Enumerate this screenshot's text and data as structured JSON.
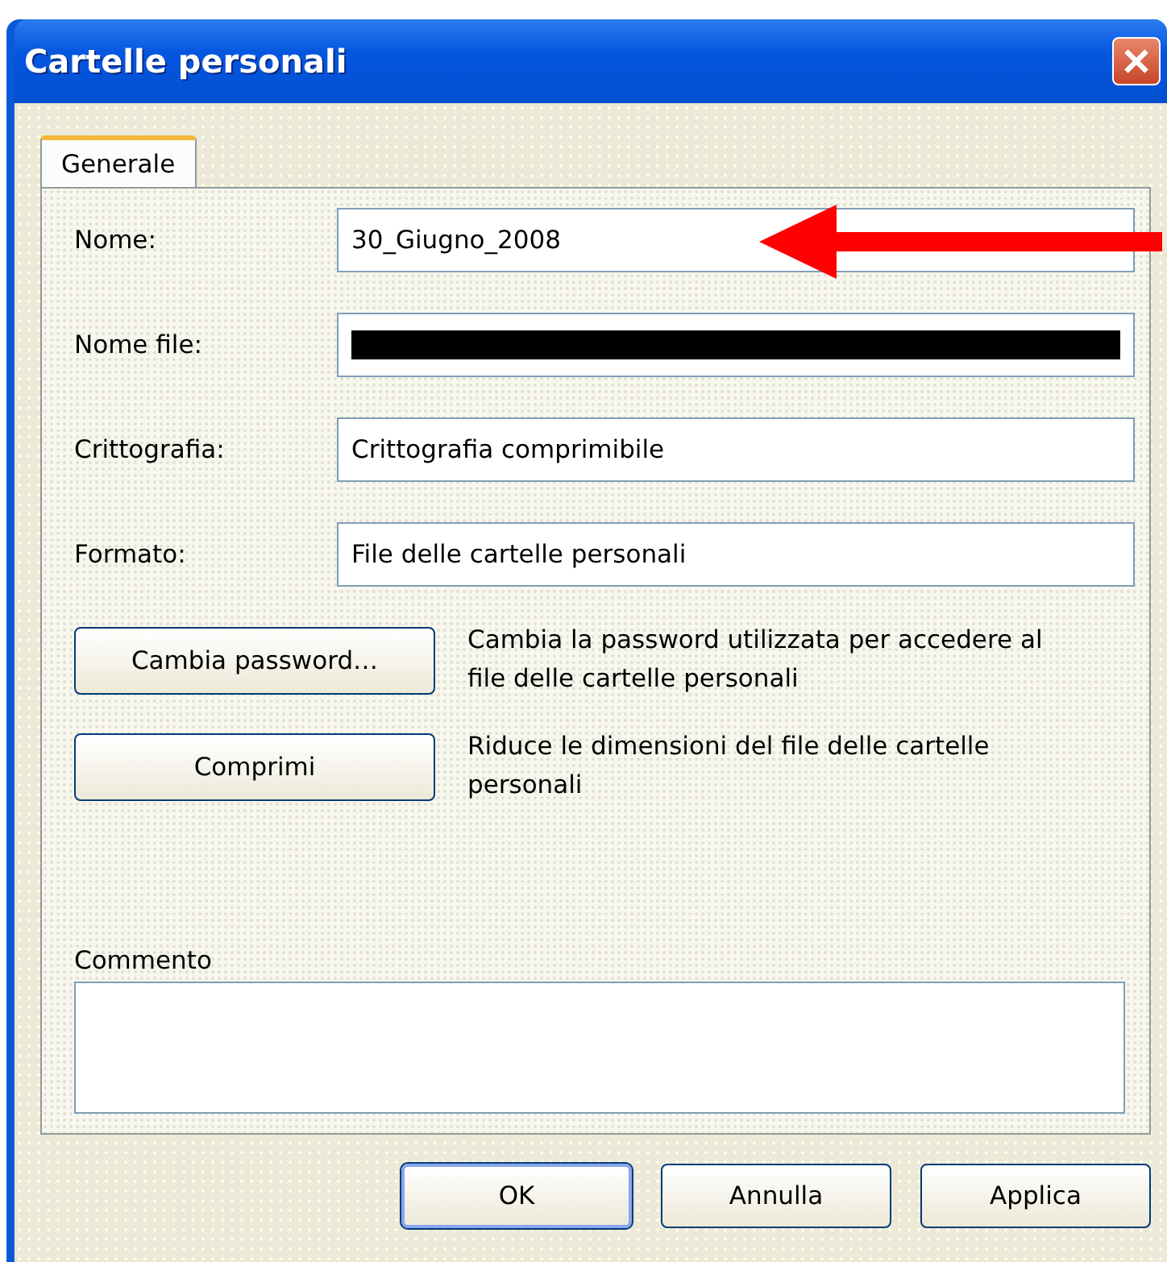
{
  "window": {
    "title": "Cartelle personali"
  },
  "tabs": [
    {
      "label": "Generale",
      "selected": true
    }
  ],
  "fields": [
    {
      "label": "Nome:",
      "value": "30_Giugno_2008",
      "kind": "text"
    },
    {
      "label": "Nome file:",
      "kind": "redacted"
    },
    {
      "label": "Crittografia:",
      "value": "Crittografia comprimibile",
      "kind": "text"
    },
    {
      "label": "Formato:",
      "value": "File delle cartelle personali",
      "kind": "text"
    }
  ],
  "actions": [
    {
      "button": "Cambia password…",
      "description": "Cambia la password utilizzata per accedere al file delle cartelle personali"
    },
    {
      "button": "Comprimi",
      "description": "Riduce le dimensioni del file delle cartelle personali"
    }
  ],
  "comment": {
    "label": "Commento"
  },
  "buttons": [
    {
      "label": "OK",
      "default": true
    },
    {
      "label": "Annulla",
      "default": false
    },
    {
      "label": "Applica",
      "default": false
    }
  ]
}
